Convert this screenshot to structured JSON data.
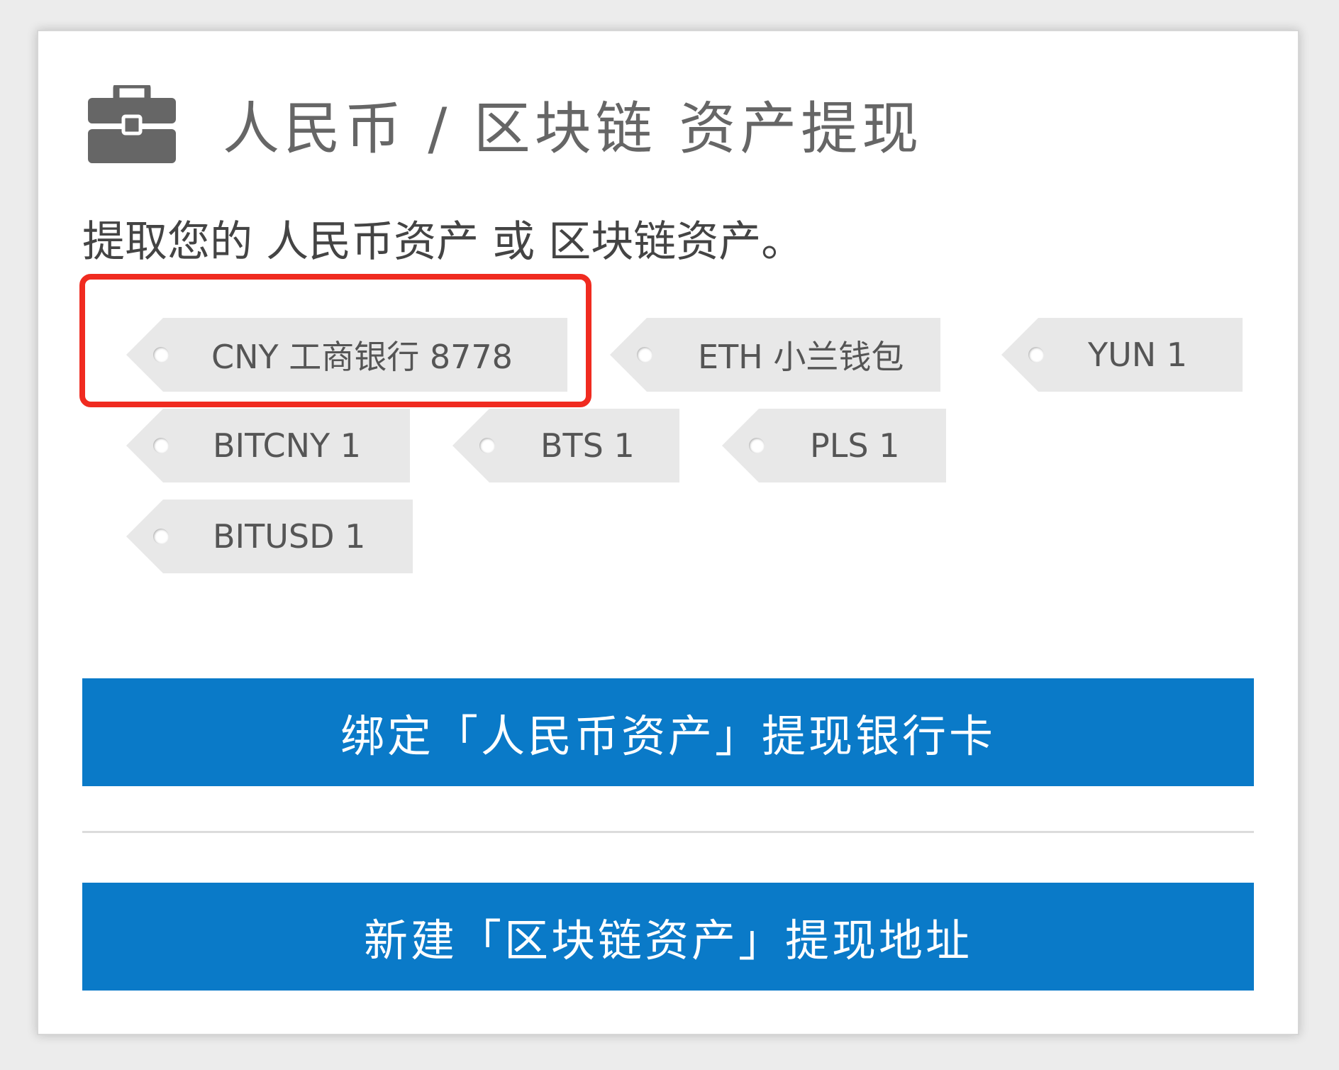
{
  "header": {
    "icon": "briefcase-icon",
    "title": "人民币 / 区块链 资产提现"
  },
  "subtitle": "提取您的 人民币资产 或 区块链资产。",
  "assets": [
    {
      "label": "CNY 工商银行 8778",
      "highlighted": true
    },
    {
      "label": "ETH 小兰钱包"
    },
    {
      "label": "YUN 1"
    },
    {
      "label": "BITCNY 1"
    },
    {
      "label": "BTS 1"
    },
    {
      "label": "PLS 1"
    },
    {
      "label": "BITUSD 1"
    }
  ],
  "actions": {
    "bind_bank_card": "绑定「人民币资产」提现银行卡",
    "new_chain_address": "新建「区块链资产」提现地址"
  },
  "colors": {
    "primary_button": "#0a7ac8",
    "highlight_border": "#f02b20",
    "tag_background": "#e8e8e8"
  }
}
